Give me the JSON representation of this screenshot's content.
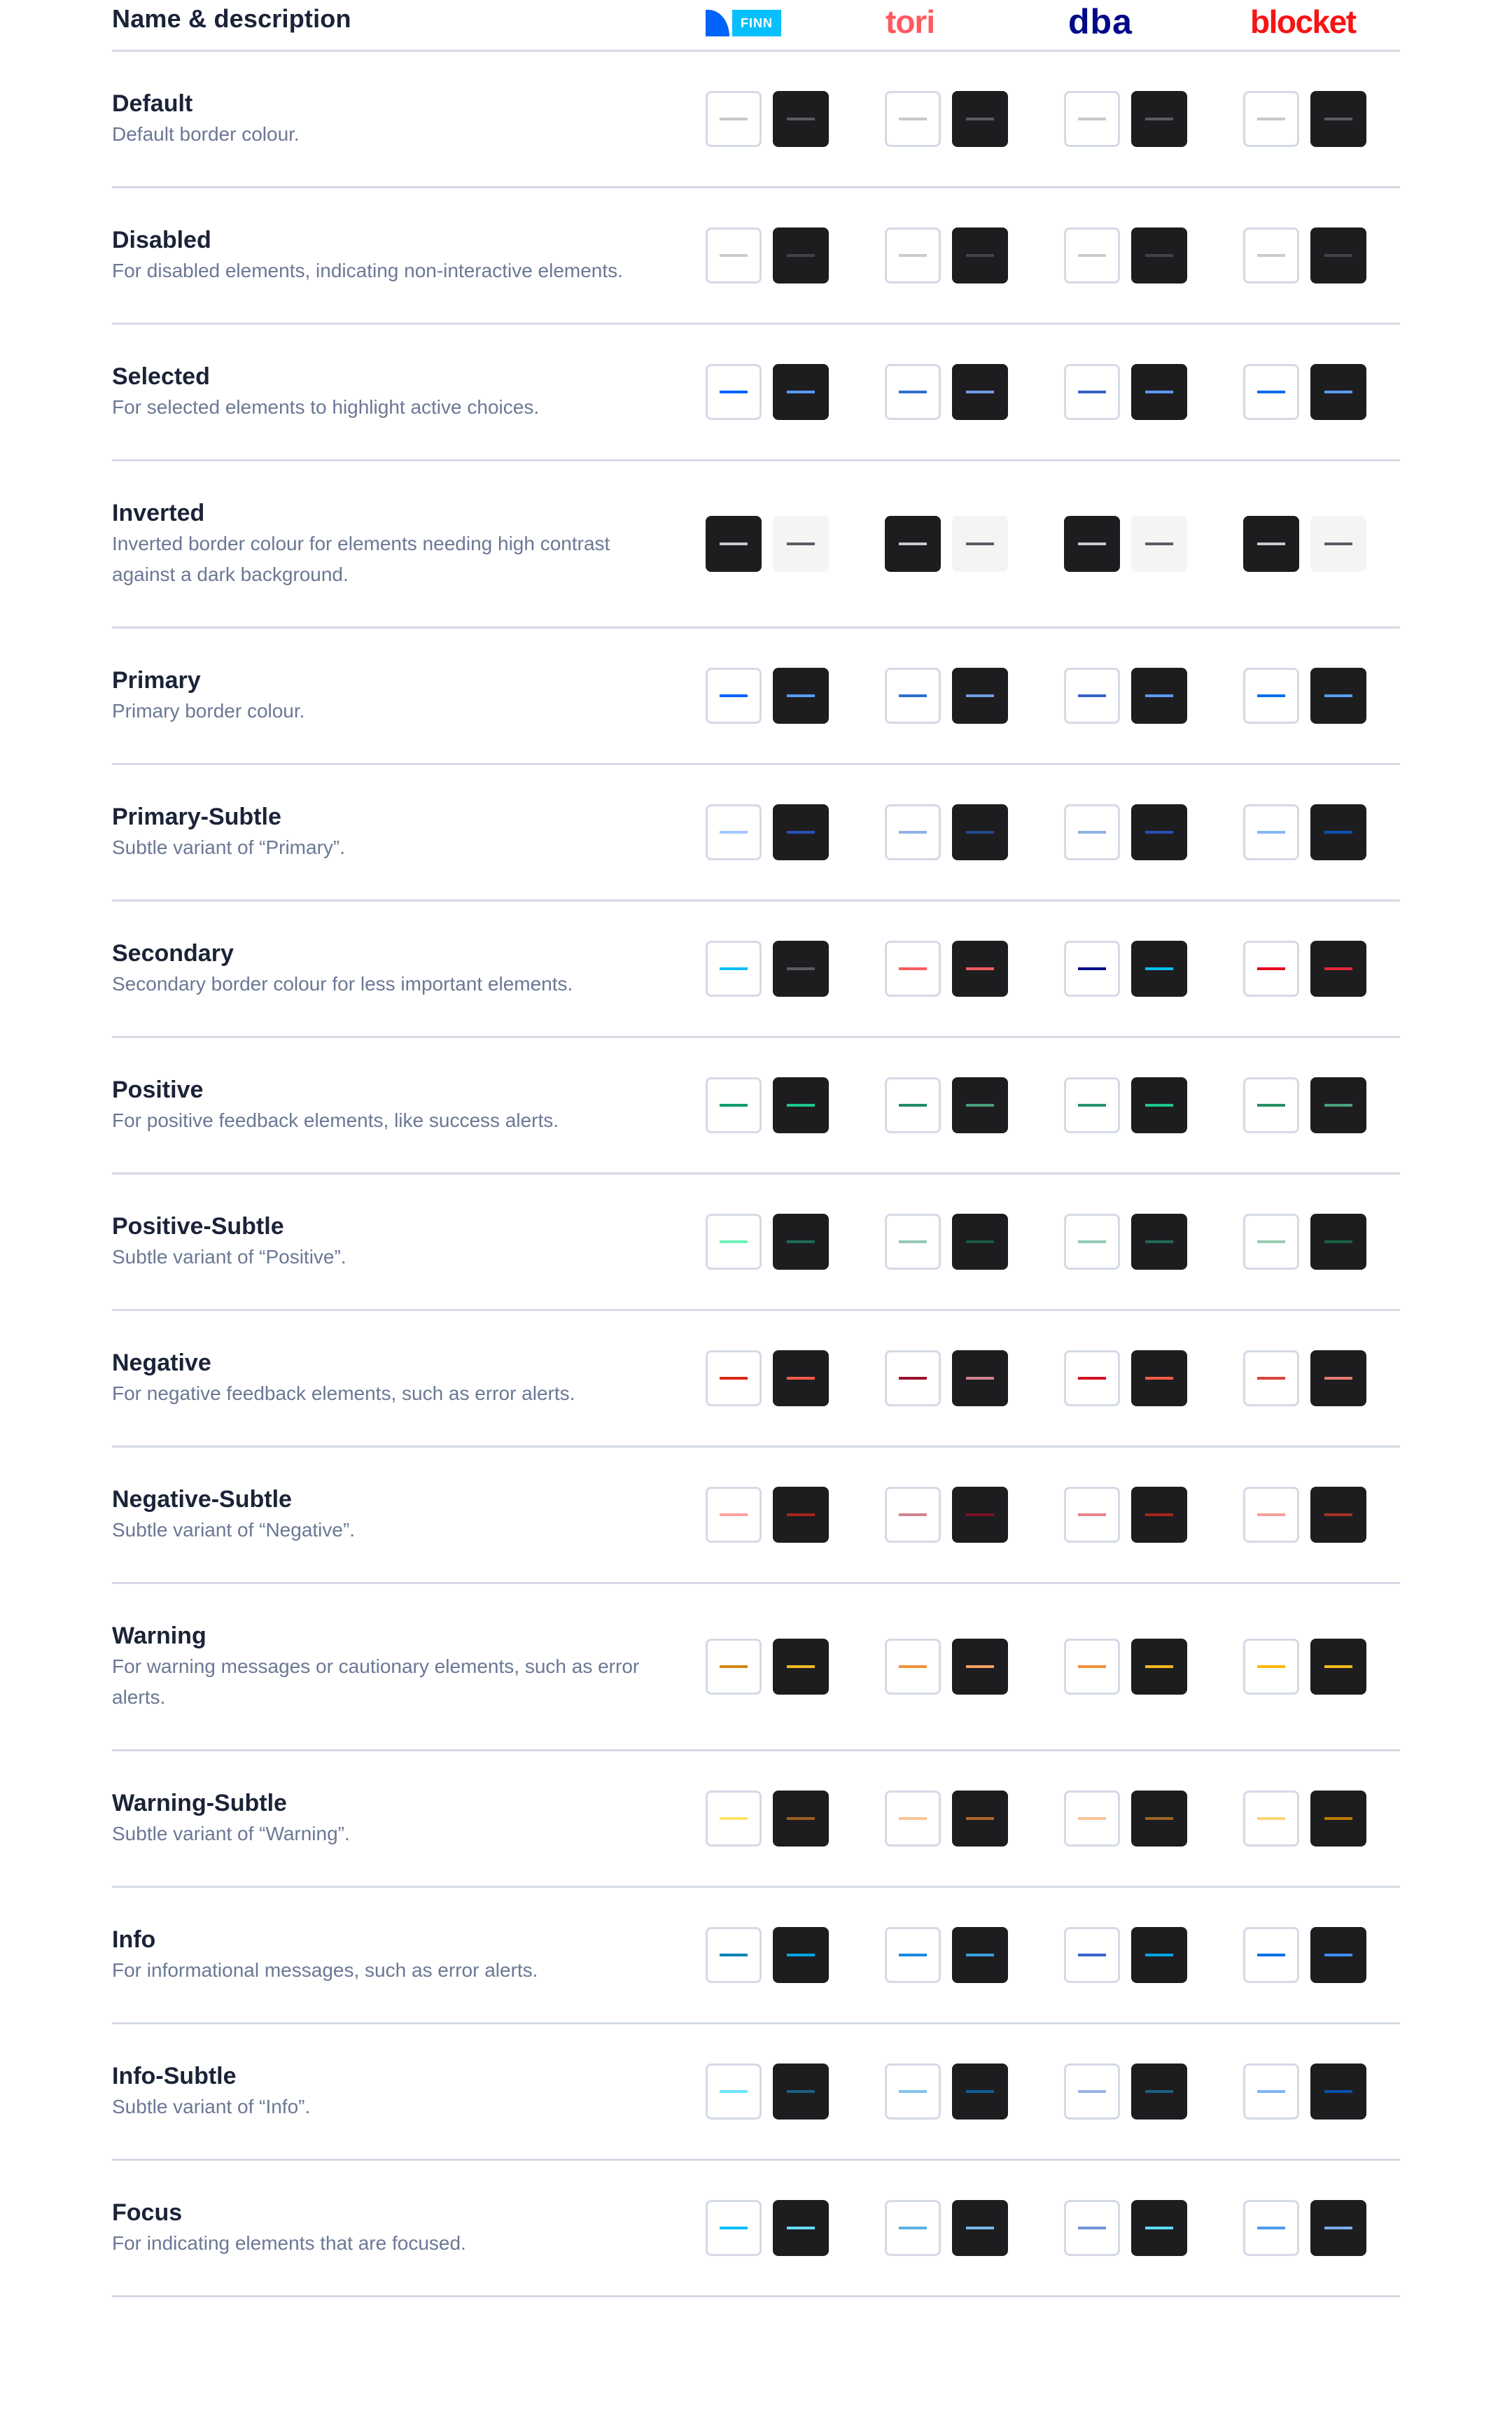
{
  "header": {
    "title": "Name & description",
    "brands": [
      {
        "id": "finn",
        "label": "FINN",
        "color": "#0063fb",
        "accent": "#06bffc"
      },
      {
        "id": "tori",
        "label": "tori",
        "color": "#ff5a5f"
      },
      {
        "id": "dba",
        "label": "dba",
        "color": "#00098a"
      },
      {
        "id": "blocket",
        "label": "blocket",
        "color": "#f71414"
      }
    ]
  },
  "rows": [
    {
      "name": "Default",
      "description": "Default border colour.",
      "swatches": [
        [
          "#c8c8cd",
          "#5b5b64"
        ],
        [
          "#c8c8cd",
          "#5b5b64"
        ],
        [
          "#c8c8cd",
          "#5b5b64"
        ],
        [
          "#c8c8cd",
          "#5b5b64"
        ]
      ]
    },
    {
      "name": "Disabled",
      "description": "For disabled elements, indicating non-interactive elements.",
      "swatches": [
        [
          "#cbcbd0",
          "#43434a"
        ],
        [
          "#cbcbd0",
          "#43434a"
        ],
        [
          "#cbcbd0",
          "#43434a"
        ],
        [
          "#cbcbd0",
          "#43434a"
        ]
      ]
    },
    {
      "name": "Selected",
      "description": "For selected elements to highlight active choices.",
      "swatches": [
        [
          "#0063fb",
          "#5a9bf5"
        ],
        [
          "#2e6fd0",
          "#6f9de0"
        ],
        [
          "#3563c7",
          "#5b9af5"
        ],
        [
          "#0b6fe8",
          "#5a9bf0"
        ]
      ]
    },
    {
      "name": "Inverted",
      "description": "Inverted border colour for elements needing high contrast against a dark background.",
      "inverted": true,
      "swatches": [
        [
          "#c8c8cd",
          "#5b5b64"
        ],
        [
          "#c8c8cd",
          "#5b5b64"
        ],
        [
          "#c8c8cd",
          "#5b5b64"
        ],
        [
          "#c8c8cd",
          "#5b5b64"
        ]
      ]
    },
    {
      "name": "Primary",
      "description": "Primary border colour.",
      "swatches": [
        [
          "#0063fb",
          "#5a9bf5"
        ],
        [
          "#2e6fd0",
          "#6f9de0"
        ],
        [
          "#3563c7",
          "#5b9af5"
        ],
        [
          "#0b6fe8",
          "#5a9bf0"
        ]
      ]
    },
    {
      "name": "Primary-Subtle",
      "description": "Subtle variant of “Primary”.",
      "swatches": [
        [
          "#a3c6ff",
          "#2a50b8"
        ],
        [
          "#8fb2e6",
          "#234b8c"
        ],
        [
          "#8fb0e3",
          "#2a4fb5"
        ],
        [
          "#82b8f5",
          "#0b52b3"
        ]
      ]
    },
    {
      "name": "Secondary",
      "description": "Secondary border colour for less important elements.",
      "swatches": [
        [
          "#06bffc",
          "#5b5b64"
        ],
        [
          "#ff5a5f",
          "#ff5a5f"
        ],
        [
          "#00098a",
          "#06bffc"
        ],
        [
          "#e8001c",
          "#e8283c"
        ]
      ]
    },
    {
      "name": "Positive",
      "description": "For positive feedback elements, like success alerts.",
      "swatches": [
        [
          "#0f9a70",
          "#1cc88c"
        ],
        [
          "#1f8b66",
          "#479d7b"
        ],
        [
          "#229370",
          "#1cc88c"
        ],
        [
          "#27905f",
          "#4a9f7c"
        ]
      ]
    },
    {
      "name": "Positive-Subtle",
      "description": "Subtle variant of “Positive”.",
      "swatches": [
        [
          "#6ff0bc",
          "#1f6b53"
        ],
        [
          "#92c9b3",
          "#165a42"
        ],
        [
          "#92c9b3",
          "#1f6b53"
        ],
        [
          "#98ccb0",
          "#176342"
        ]
      ]
    },
    {
      "name": "Negative",
      "description": "For negative feedback elements, such as error alerts.",
      "swatches": [
        [
          "#d9270f",
          "#ff5a48"
        ],
        [
          "#9a0f2a",
          "#d1848f"
        ],
        [
          "#d4101e",
          "#ff5a48"
        ],
        [
          "#d7433a",
          "#e77a70"
        ]
      ]
    },
    {
      "name": "Negative-Subtle",
      "description": "Subtle variant of “Negative”.",
      "swatches": [
        [
          "#ffa0a0",
          "#a6241b"
        ],
        [
          "#d0838e",
          "#7c1126"
        ],
        [
          "#ea848b",
          "#a6241b"
        ],
        [
          "#f0a19b",
          "#a33124"
        ]
      ]
    },
    {
      "name": "Warning",
      "description": "For warning messages or cautionary elements, such as error alerts.",
      "swatches": [
        [
          "#d48510",
          "#f0b820"
        ],
        [
          "#f0913a",
          "#f2a060"
        ],
        [
          "#f0913a",
          "#f0b820"
        ],
        [
          "#ffb70a",
          "#f5bb1c"
        ]
      ]
    },
    {
      "name": "Warning-Subtle",
      "description": "Subtle variant of “Warning”.",
      "swatches": [
        [
          "#fbe46a",
          "#9c5f20"
        ],
        [
          "#f9c494",
          "#b2642a"
        ],
        [
          "#f9c494",
          "#9c6424"
        ],
        [
          "#fcd675",
          "#ba7a08"
        ]
      ]
    },
    {
      "name": "Info",
      "description": "For informational messages, such as error alerts.",
      "swatches": [
        [
          "#0a82b4",
          "#04a4e0"
        ],
        [
          "#1a8ae0",
          "#3c9fe0"
        ],
        [
          "#3866c8",
          "#04a4e0"
        ],
        [
          "#0b6fe8",
          "#3d8ef0"
        ]
      ]
    },
    {
      "name": "Info-Subtle",
      "description": "Subtle variant of “Info”.",
      "swatches": [
        [
          "#6ee4fb",
          "#1b5e82"
        ],
        [
          "#82c4ec",
          "#0d5e96"
        ],
        [
          "#98b2e4",
          "#1b5e82"
        ],
        [
          "#7eb6f3",
          "#0650b0"
        ]
      ]
    },
    {
      "name": "Focus",
      "description": "For indicating elements that are focused.",
      "swatches": [
        [
          "#06bffc",
          "#66dcfa"
        ],
        [
          "#5cb0e6",
          "#7ab8e8"
        ],
        [
          "#7193d8",
          "#5cdcfa"
        ],
        [
          "#4f9ceb",
          "#7aaeea"
        ]
      ]
    }
  ]
}
